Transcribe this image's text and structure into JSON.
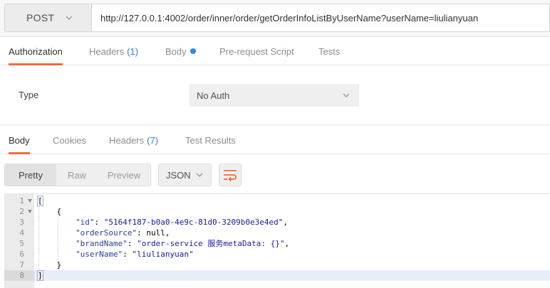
{
  "request": {
    "method": "POST",
    "url": "http://127.0.0.1:4002/order/inner/order/getOrderInfoListByUserName?userName=liulianyuan"
  },
  "request_tabs": [
    {
      "label": "Authorization",
      "count": "",
      "active": true
    },
    {
      "label": "Headers",
      "count": "(1)",
      "active": false
    },
    {
      "label": "Body",
      "count": "",
      "active": false,
      "has_dot": true
    },
    {
      "label": "Pre-request Script",
      "count": "",
      "active": false
    },
    {
      "label": "Tests",
      "count": "",
      "active": false
    }
  ],
  "auth": {
    "type_label": "Type",
    "type_value": "No Auth"
  },
  "response_tabs": [
    {
      "label": "Body",
      "count": "",
      "active": true
    },
    {
      "label": "Cookies",
      "count": "",
      "active": false
    },
    {
      "label": "Headers",
      "count": "(7)",
      "active": false
    },
    {
      "label": "Test Results",
      "count": "",
      "active": false
    }
  ],
  "response_toolbar": {
    "views": [
      "Pretty",
      "Raw",
      "Preview"
    ],
    "active_view": "Pretty",
    "format": "JSON"
  },
  "response_body": {
    "lines": [
      {
        "n": "1",
        "fold": true,
        "parts": [
          {
            "t": "[",
            "c": "punc"
          }
        ]
      },
      {
        "n": "2",
        "fold": true,
        "parts": [
          {
            "t": "    {",
            "c": "punc"
          }
        ]
      },
      {
        "n": "3",
        "fold": false,
        "parts": [
          {
            "t": "        ",
            "c": "punc"
          },
          {
            "t": "\"id\"",
            "c": "key"
          },
          {
            "t": ": ",
            "c": "punc"
          },
          {
            "t": "\"5164f187-b0a0-4e9c-81d0-3209b0e3e4ed\"",
            "c": "str"
          },
          {
            "t": ",",
            "c": "punc"
          }
        ]
      },
      {
        "n": "4",
        "fold": false,
        "parts": [
          {
            "t": "        ",
            "c": "punc"
          },
          {
            "t": "\"orderSource\"",
            "c": "key"
          },
          {
            "t": ": ",
            "c": "punc"
          },
          {
            "t": "null",
            "c": "null"
          },
          {
            "t": ",",
            "c": "punc"
          }
        ]
      },
      {
        "n": "5",
        "fold": false,
        "parts": [
          {
            "t": "        ",
            "c": "punc"
          },
          {
            "t": "\"brandName\"",
            "c": "key"
          },
          {
            "t": ": ",
            "c": "punc"
          },
          {
            "t": "\"order-service 服务metaData: {}\"",
            "c": "str"
          },
          {
            "t": ",",
            "c": "punc"
          }
        ]
      },
      {
        "n": "6",
        "fold": false,
        "parts": [
          {
            "t": "        ",
            "c": "punc"
          },
          {
            "t": "\"userName\"",
            "c": "key"
          },
          {
            "t": ": ",
            "c": "punc"
          },
          {
            "t": "\"liulianyuan\"",
            "c": "str"
          }
        ]
      },
      {
        "n": "7",
        "fold": false,
        "parts": [
          {
            "t": "    }",
            "c": "punc"
          }
        ]
      },
      {
        "n": "8",
        "fold": false,
        "active": true,
        "parts": [
          {
            "t": "]",
            "c": "punc"
          }
        ]
      }
    ]
  },
  "colors": {
    "accent": "#f26b3a",
    "count_blue": "#3a7bd5",
    "dot_blue": "#2f86e6"
  },
  "icons": {
    "method_caret": "chevron-down-icon",
    "auth_caret": "chevron-down-icon",
    "format_caret": "chevron-down-icon",
    "wrap": "wrap-lines-icon",
    "fold": "fold-arrow-icon"
  }
}
